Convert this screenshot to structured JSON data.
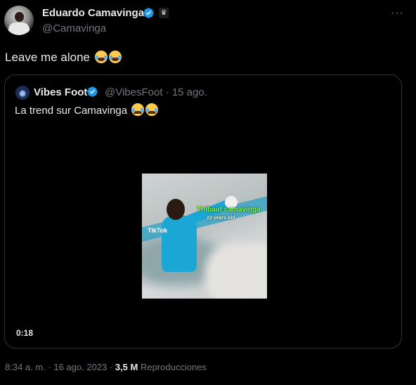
{
  "author": {
    "name": "Eduardo Camavinga",
    "handle": "@Camavinga"
  },
  "tweet": {
    "text": "Leave me alone",
    "emojis": [
      "face-with-tears-of-joy",
      "face-with-tears-of-joy"
    ]
  },
  "quoted": {
    "name": "Vibes Foot",
    "handle": "@VibesFoot",
    "date": "· 15 ago.",
    "text": "La trend sur Camavinga",
    "emojis": [
      "loudly-crying-face",
      "loudly-crying-face"
    ],
    "video": {
      "duration": "0:18",
      "overlay_title": "Thibaut camavinga",
      "overlay_sub": "23 years old",
      "watermark": "TikTok"
    }
  },
  "meta": {
    "time": "8:34 a. m.",
    "date": "16 ago. 2023",
    "views": "3,5 M",
    "views_label": "Reproducciones"
  },
  "colors": {
    "background": "#000000",
    "text": "#e7e9ea",
    "muted": "#71767b",
    "verified": "#1d9bf0",
    "border": "#2f3336"
  }
}
